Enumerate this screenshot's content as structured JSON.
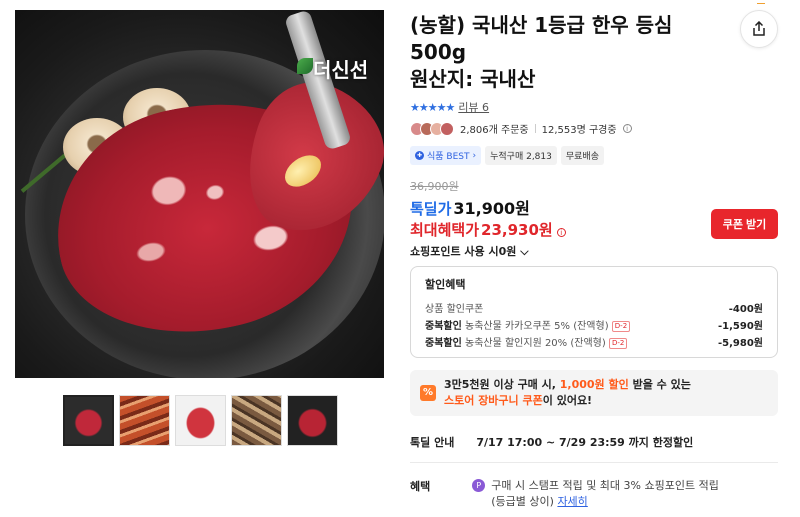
{
  "gallery": {
    "watermark": "더신선",
    "thumbnails": [
      "thumb-1",
      "thumb-2",
      "thumb-3",
      "thumb-4",
      "thumb-5"
    ]
  },
  "product": {
    "title_line1": "(농할) 국내산 1등급 한우 등심",
    "title_line2": "500g",
    "title_line3": "원산지: 국내산",
    "rating_stars": "★★★★★",
    "review_label": "리뷰 6",
    "orders": "2,806개 주문중",
    "subscribers": "12,553명 구경중",
    "badges": {
      "best": "식품 BEST",
      "cumulative": "누적구매 2,813",
      "shipping": "무료배송"
    }
  },
  "pricing": {
    "original": "36,900원",
    "deal_label": "톡딜가",
    "deal_price": "31,900원",
    "benefit_label": "최대혜택가",
    "benefit_price": "23,930원",
    "coupon_button": "쿠폰 받기",
    "point_usage": "쇼핑포인트 사용 시0원"
  },
  "discounts": {
    "title": "할인혜택",
    "rows": [
      {
        "prefix": "",
        "label": "상품 할인쿠폰",
        "tag": "",
        "amount": "-400원"
      },
      {
        "prefix": "중복할인",
        "label": " 농축산물 카카오쿠폰 5% (잔액형)",
        "tag": "D-2",
        "amount": "-1,590원"
      },
      {
        "prefix": "중복할인",
        "label": " 농축산물 할인지원 20% (잔액형)",
        "tag": "D-2",
        "amount": "-5,980원"
      }
    ]
  },
  "promo": {
    "line1_a": "3만5천원 이상 구매 시, ",
    "line1_hl": "1,000원 할인",
    "line1_b": " 받을 수 있는",
    "line2_hl": "스토어 장바구니 쿠폰",
    "line2_b": "이 있어요!"
  },
  "deal_info": {
    "label": "톡딜 안내",
    "text": "7/17 17:00 ~ 7/29 23:59 까지 한정할인"
  },
  "perks": {
    "label": "혜택",
    "line1": "구매 시 스탬프 적립 및 최대 3% 쇼핑포인트 적립",
    "line2_a": "(등급별 상이) ",
    "line2_link": "자세히"
  },
  "colors": {
    "accent_blue": "#1f6be6",
    "accent_red": "#e0262b",
    "promo_orange": "#ff5a1a"
  }
}
